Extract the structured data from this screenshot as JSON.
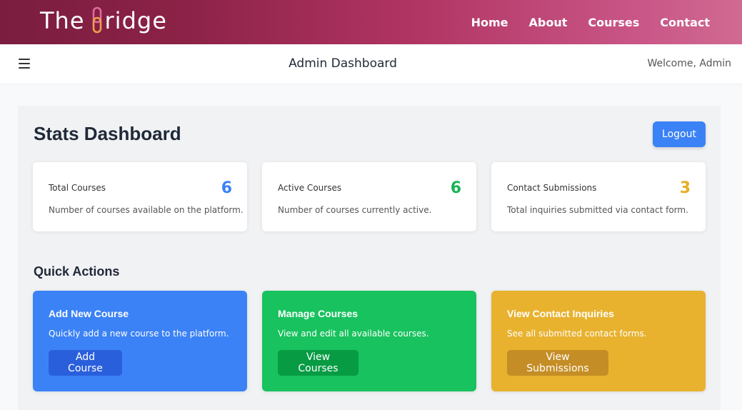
{
  "brand": {
    "prefix": "The",
    "suffix": "ridge"
  },
  "nav": {
    "items": [
      {
        "label": "Home"
      },
      {
        "label": "About"
      },
      {
        "label": "Courses"
      },
      {
        "label": "Contact"
      }
    ]
  },
  "header": {
    "title": "Admin Dashboard",
    "welcome": "Welcome, Admin",
    "menu_icon": "hamburger-menu-icon"
  },
  "dashboard": {
    "title": "Stats Dashboard",
    "logout_label": "Logout"
  },
  "stats": [
    {
      "label": "Total Courses",
      "value": "6",
      "color": "#3b82f6",
      "description": "Number of courses available on the platform."
    },
    {
      "label": "Active Courses",
      "value": "6",
      "color": "#16b553",
      "description": "Number of courses currently active."
    },
    {
      "label": "Contact Submissions",
      "value": "3",
      "color": "#e6ad24",
      "description": "Total inquiries submitted via contact form."
    }
  ],
  "quick_actions": {
    "title": "Quick Actions",
    "items": [
      {
        "title": "Add New Course",
        "description": "Quickly add a new course to the platform.",
        "button": "Add Course",
        "color": "#3b82f6"
      },
      {
        "title": "Manage Courses",
        "description": "View and edit all available courses.",
        "button": "View Courses",
        "color": "#18c25e"
      },
      {
        "title": "View Contact Inquiries",
        "description": "See all submitted contact forms.",
        "button": "View Submissions",
        "color": "#e8b22f"
      }
    ]
  },
  "colors": {
    "nav_gradient_start": "#7a1d3f",
    "nav_gradient_end": "#d06a92",
    "logo_link": "#f0a04b"
  }
}
